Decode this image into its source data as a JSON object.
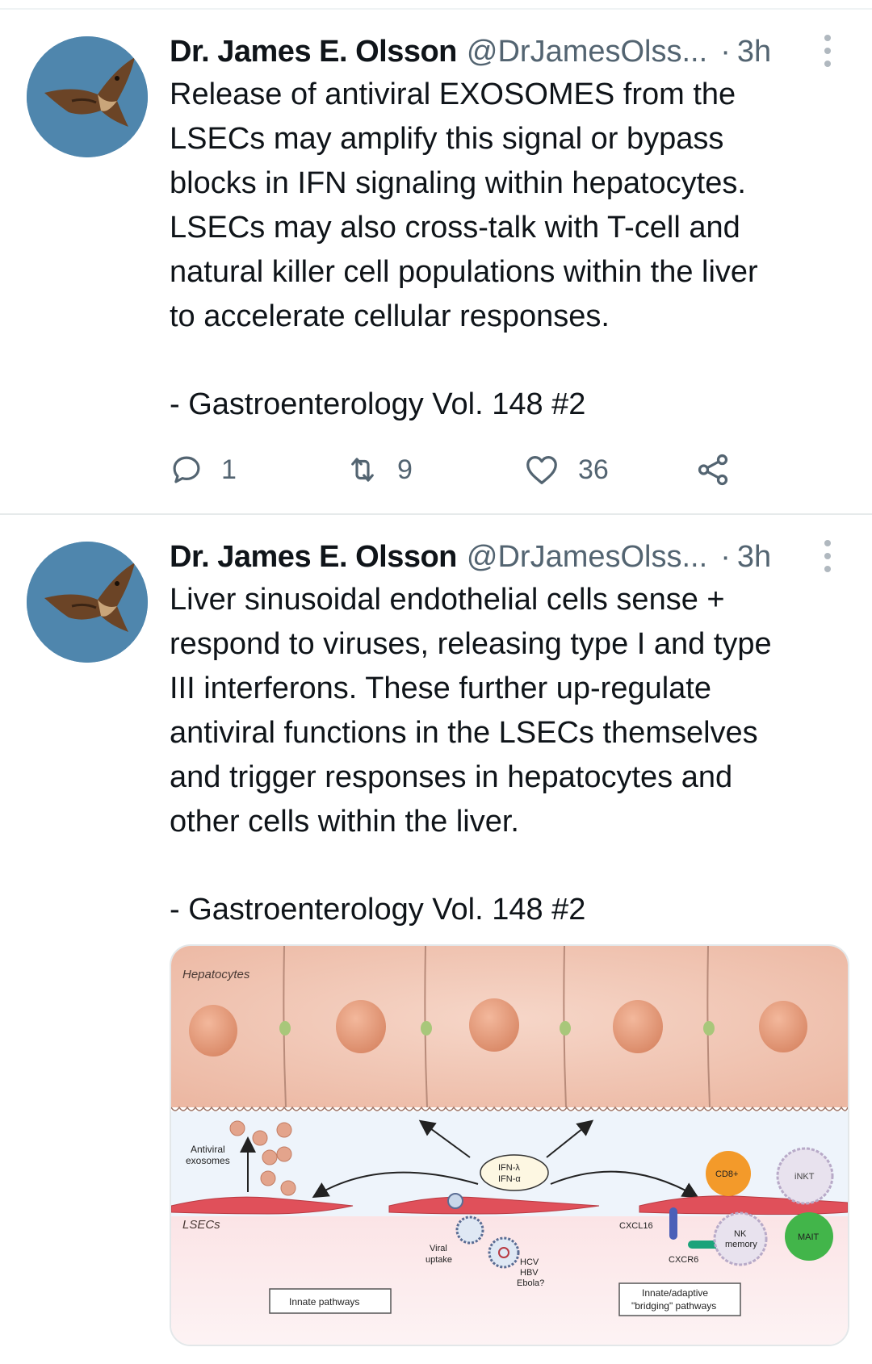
{
  "tweets": [
    {
      "author_name": "Dr. James E. Olsson",
      "handle": "@DrJamesOlss...",
      "separator": "·",
      "time": "3h",
      "avatar_icon": "hawk-avatar-icon",
      "body_lines": [
        "Release of antiviral EXOSOMES from the",
        "LSECs may amplify this signal or bypass",
        "blocks in IFN signaling within hepatocytes.",
        "LSECs may also cross-talk with T-cell and",
        "natural killer cell populations within the liver",
        "to accelerate cellular responses."
      ],
      "citation": "- Gastroenterology Vol. 148 #2",
      "actions": {
        "replies": "1",
        "retweets": "9",
        "likes": "36"
      }
    },
    {
      "author_name": "Dr. James E. Olsson",
      "handle": "@DrJamesOlss...",
      "separator": "·",
      "time": "3h",
      "avatar_icon": "hawk-avatar-icon",
      "body_lines": [
        "Liver sinusoidal endothelial cells sense +",
        "respond to viruses, releasing type I and type",
        "III interferons. These further up-regulate",
        "antiviral functions in the LSECs themselves",
        "and trigger responses in hepatocytes and",
        "other cells within the liver."
      ],
      "citation": "- Gastroenterology Vol. 148 #2"
    }
  ],
  "figure": {
    "hepatocytes_label": "Hepatocytes",
    "antiviral_label_1": "Antiviral",
    "antiviral_label_2": "exosomes",
    "ifn_lambda": "IFN-λ",
    "ifn_alpha": "IFN-α",
    "lsecs_label": "LSECs",
    "viral_label_1": "Viral",
    "viral_label_2": "uptake",
    "virus_1": "HCV",
    "virus_2": "HBV",
    "virus_3": "Ebola?",
    "cxcl16": "CXCL16",
    "cxcr6": "CXCR6",
    "cd8": "CD8+",
    "inkt": "iNKT",
    "nk_1": "NK",
    "nk_2": "memory",
    "mait": "MAIT",
    "innate_box": "Innate pathways",
    "bridging_1": "Innate/adaptive",
    "bridging_2": "\"bridging\" pathways"
  },
  "colors": {
    "text": "#0f1419",
    "secondary": "#536471",
    "avatar_sky": "#4f86ad",
    "hepatocyte": "#f0c2ae",
    "nucleus": "#e59a7a",
    "lsec": "#e0505a",
    "cd8": "#f39a2a",
    "mait": "#42b54a",
    "cxcl16": "#4a60b8",
    "cxcr6": "#1aa37a"
  }
}
